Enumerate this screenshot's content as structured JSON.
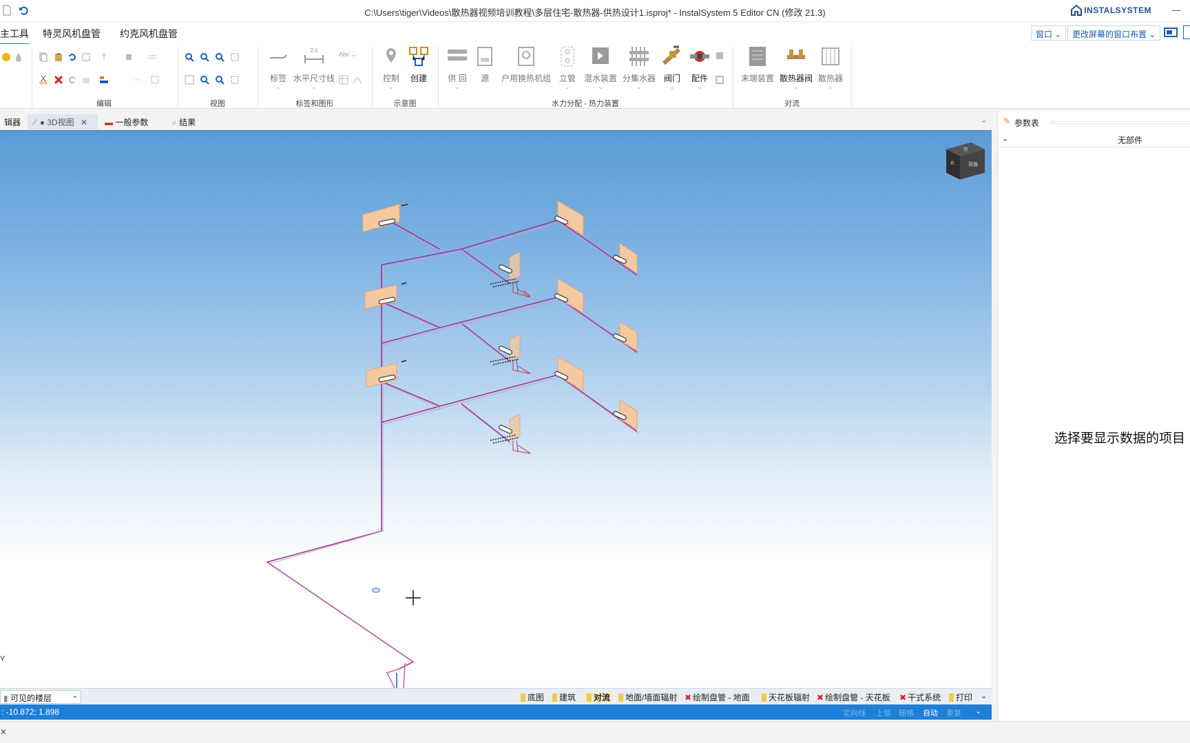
{
  "window": {
    "title": "C:\\Users\\tiger\\Videos\\散热器视频培训教程\\多层住宅-散热器-供热设计1.isproj* - InstalSystem 5 Editor CN (修改 21.3)",
    "brand": "INSTALSYSTEM",
    "minimize": "—"
  },
  "ribbon_tabs": [
    "主工具",
    "特灵风机盘管",
    "约克风机盘管"
  ],
  "window_tools": {
    "window_btn": "窗口",
    "layout_btn": "更改屏幕的窗口布置"
  },
  "ribbon": {
    "groups": {
      "edit": "编辑",
      "view": "视图",
      "labels": "标签和图形",
      "diagram": "示意图",
      "hydro": "水力分配 - 热力装置",
      "convection": "对流"
    },
    "buttons": {
      "label": "标签",
      "hdim": "水平尺寸线",
      "hdim_value": "2.0",
      "abc": "Abc",
      "control": "控制",
      "create": "创建",
      "supply_return": "供 回",
      "source": "源",
      "household_hx": "户用换热机组",
      "riser": "立管",
      "mixing": "混水装置",
      "manifold": "分集水器",
      "valve": "阀门",
      "fitting": "配件",
      "end_device": "末端装置",
      "radiator_valve": "散热器阀",
      "radiator": "散热器"
    }
  },
  "doc_tabs": {
    "left_stub": "辑器",
    "view3d": "● 3D视图",
    "general": "一般参数",
    "results": "结果"
  },
  "navcube": {
    "top": "顶",
    "front": "背面",
    "side": "右"
  },
  "bottom": {
    "floors": "可见的楼层",
    "layers": [
      "底图",
      "建筑",
      "对流",
      "地面/墙面辐射",
      "绘制盘管 - 地面",
      "天花板辐射",
      "绘制盘管 - 天花板",
      "干式系统",
      "打印"
    ],
    "active_layer": "对流",
    "axis_label": "Y"
  },
  "status": {
    "coords": ": -10.872; 1.898",
    "items": [
      "定向线",
      "上锁",
      "栅格",
      "自动",
      "重复"
    ],
    "active": "自动"
  },
  "panel": {
    "title": "参数表",
    "subtitle": "无部件",
    "message": "选择要显示数据的项目"
  },
  "colors": {
    "accent": "#1e7fd6",
    "pipe_supply": "#a0388a",
    "pipe_return": "#c8a0d8",
    "radiator": "#f4c8a0"
  }
}
